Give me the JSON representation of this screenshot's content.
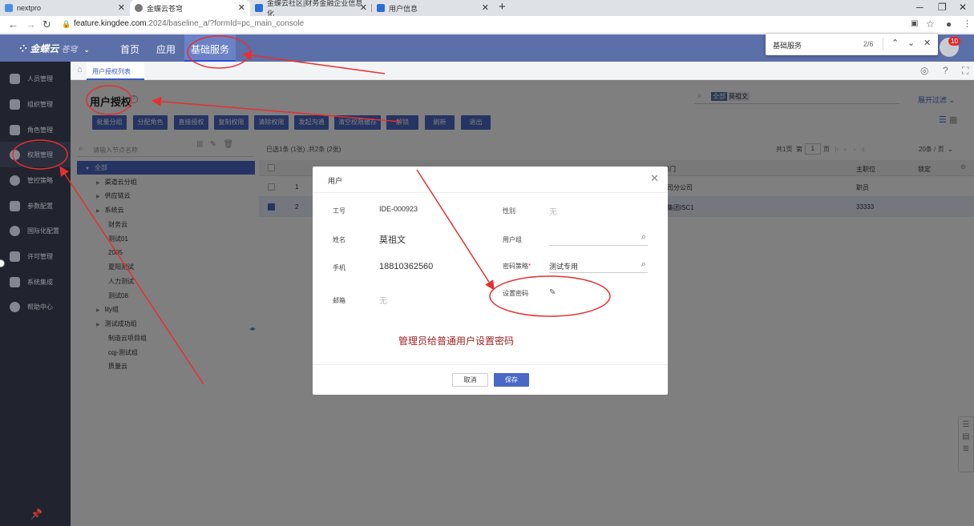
{
  "browser": {
    "tabs": [
      {
        "title": "nextpro",
        "color": "#4a90e2"
      },
      {
        "title": "金蝶云苍穹",
        "color": "#777777"
      },
      {
        "title": "金蝶云社区|财务金融企业信息化",
        "color": "#2b6fd6"
      },
      {
        "title": "用户信息",
        "color": "#2b6fd6"
      }
    ],
    "url_host": "feature.kingdee.com",
    "url_path": ":2024/baseline_a/?formId=pc_main_console"
  },
  "findbar": {
    "query": "基础服务",
    "count": "2/6"
  },
  "app": {
    "logo": "金蝶云",
    "logo_sub": "苍穹",
    "nav": [
      "首页",
      "应用",
      "基础服务"
    ],
    "badge": "10"
  },
  "sidebar": {
    "items": [
      {
        "label": "人员管理",
        "icon": "person-icon"
      },
      {
        "label": "组织管理",
        "icon": "org-icon"
      },
      {
        "label": "角色管理",
        "icon": "role-icon"
      },
      {
        "label": "权限管理",
        "icon": "permission-icon"
      },
      {
        "label": "管控策略",
        "icon": "policy-icon"
      },
      {
        "label": "参数配置",
        "icon": "gear-icon"
      },
      {
        "label": "国际化配置",
        "icon": "globe-icon"
      },
      {
        "label": "许可管理",
        "icon": "license-icon"
      },
      {
        "label": "系统集成",
        "icon": "integration-icon"
      },
      {
        "label": "帮助中心",
        "icon": "help-icon"
      }
    ]
  },
  "page": {
    "breadcrumb": "用户授权列表",
    "title": "用户授权",
    "search_chip_all": "全部",
    "search_chip_value": "莫祖文",
    "expand_filter": "展开过滤",
    "toolbar": [
      "批量分组",
      "分配角色",
      "直接授权",
      "复制权限",
      "清除权限",
      "发起沟通",
      "清空权限缓存",
      "解锁",
      "刷新",
      "退出"
    ]
  },
  "tree": {
    "placeholder": "请输入节点名称",
    "nodes": [
      {
        "label": "全部",
        "level": 0,
        "arrow": "▼",
        "selected": true
      },
      {
        "label": "渠道云分组",
        "level": 1,
        "arrow": "▶"
      },
      {
        "label": "供应链云",
        "level": 1,
        "arrow": "▶"
      },
      {
        "label": "系统云",
        "level": 1,
        "arrow": "▶"
      },
      {
        "label": "财务云",
        "level": 1,
        "arrow": ""
      },
      {
        "label": "测试01",
        "level": 1,
        "arrow": ""
      },
      {
        "label": "2005",
        "level": 1,
        "arrow": ""
      },
      {
        "label": "夏阳测试",
        "level": 1,
        "arrow": ""
      },
      {
        "label": "人力测试",
        "level": 1,
        "arrow": ""
      },
      {
        "label": "测试08",
        "level": 1,
        "arrow": ""
      },
      {
        "label": "lily组",
        "level": 1,
        "arrow": "▶"
      },
      {
        "label": "测试成功组",
        "level": 1,
        "arrow": "▶"
      },
      {
        "label": "制造云项目组",
        "level": 1,
        "arrow": ""
      },
      {
        "label": "cqj-测试组",
        "level": 1,
        "arrow": ""
      },
      {
        "label": "质量云",
        "level": 1,
        "arrow": ""
      }
    ]
  },
  "grid": {
    "info": "已选1条 (1张) ,共2条 (2张)",
    "pager_total": "共1页",
    "pager_prefix": "第",
    "pager_page": "1",
    "pager_suffix": "页",
    "page_size": "20条 / 页",
    "col_dept": "部门",
    "col_position": "主职位",
    "col_locked": "锁定",
    "rows": [
      {
        "no": "1",
        "dept": "司分公司",
        "position": "职员",
        "checked": false
      },
      {
        "no": "2",
        "dept": "集团ISC1",
        "position": "33333",
        "checked": true
      }
    ]
  },
  "dialog": {
    "title": "用户",
    "fields": {
      "empno_label": "工号",
      "empno": "IDE-000923",
      "gender_label": "性别",
      "gender": "无",
      "name_label": "姓名",
      "name": "莫祖文",
      "group_label": "用户组",
      "group": "",
      "phone_label": "手机",
      "phone": "18810362560",
      "pwdpolicy_label": "密码策略",
      "pwdpolicy": "测试专用",
      "email_label": "邮箱",
      "email": "无",
      "setpwd_label": "设置密码"
    },
    "caption": "管理员给普通用户设置密码",
    "cancel": "取消",
    "save": "保存"
  },
  "colors": {
    "accent": "#4a68c5",
    "header": "#5b6fa8",
    "sidebar": "#2e3140",
    "annotation": "#e53030"
  }
}
